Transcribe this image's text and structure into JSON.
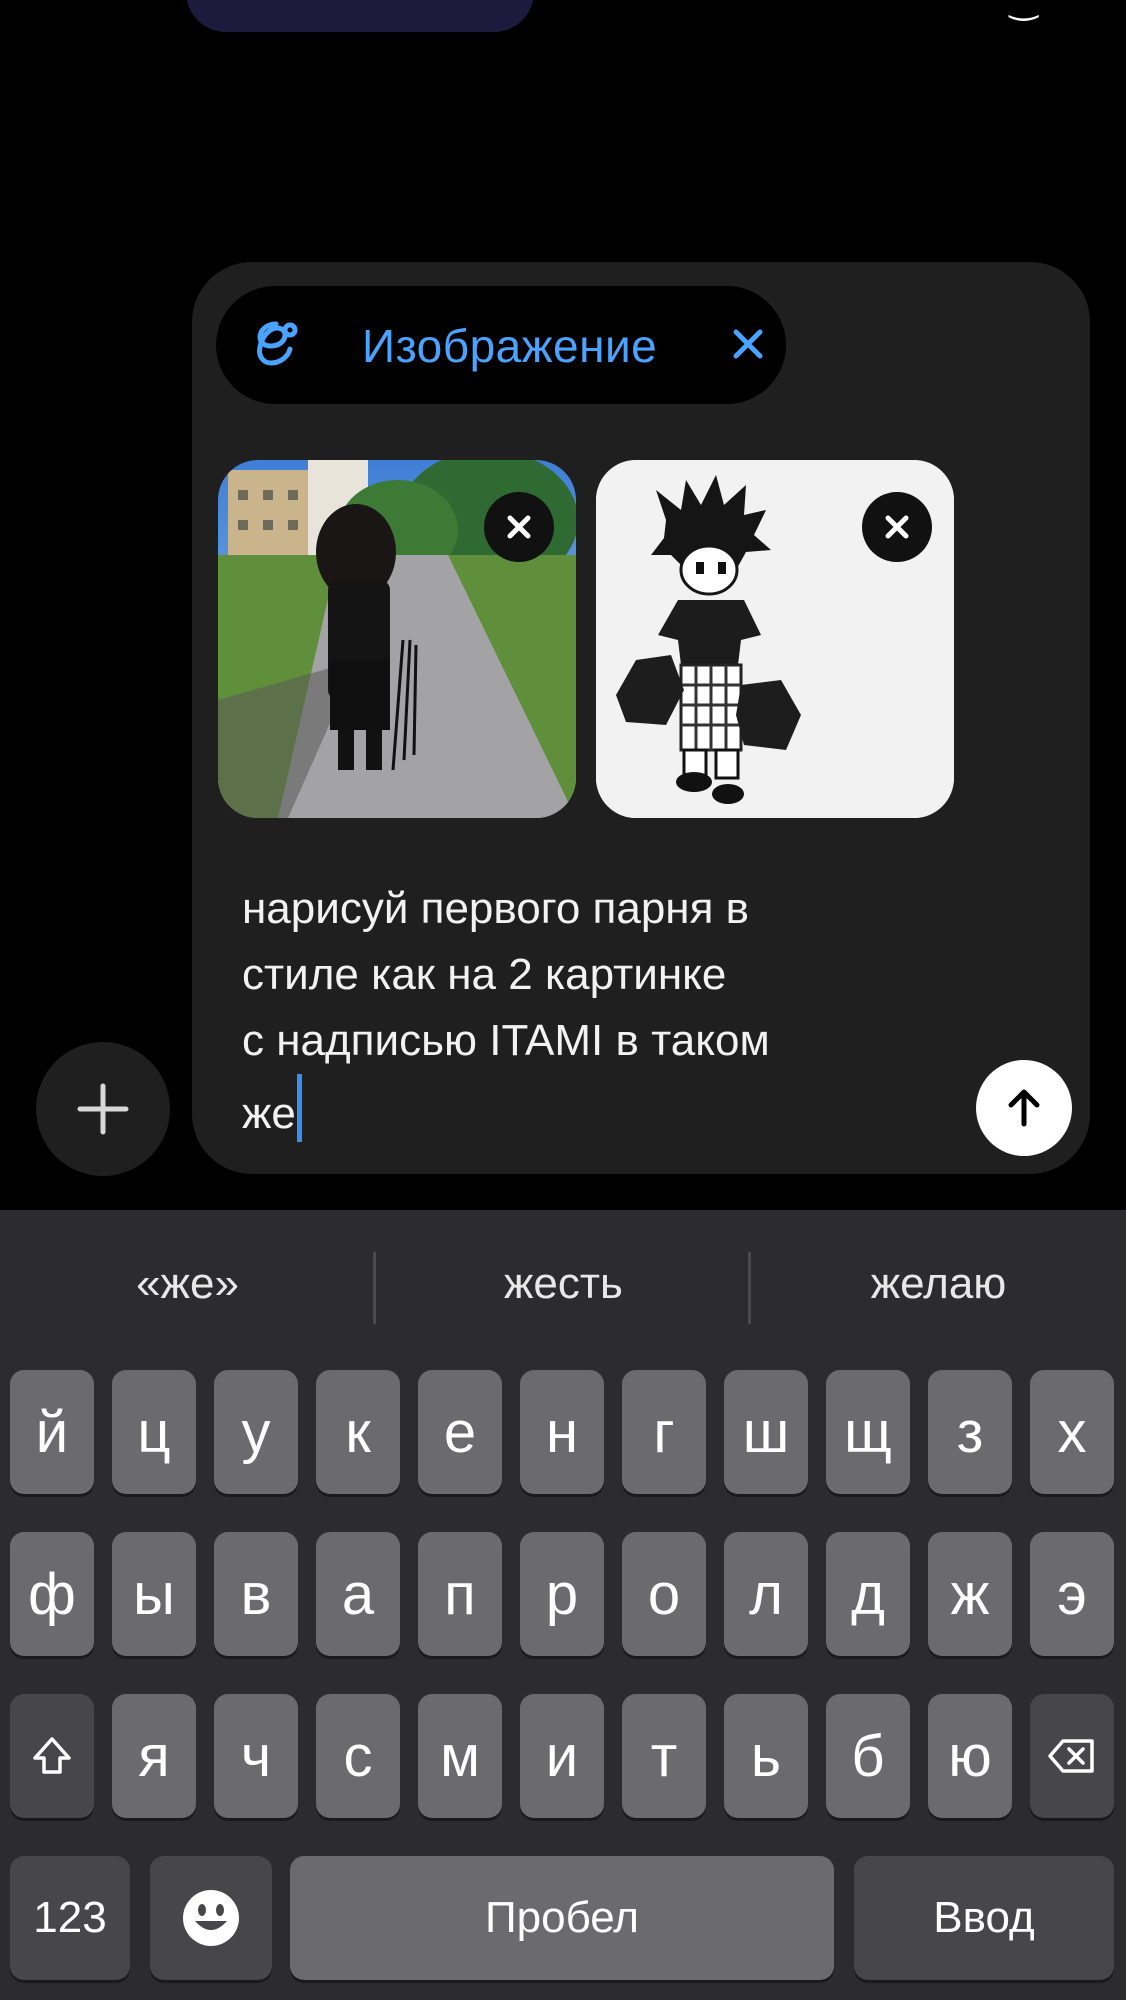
{
  "composer": {
    "chip_label": "Изображение",
    "message_text": "нарисуй первого парня в стиле как на 2 картинке с надписью ITAMI в таком же",
    "message_lines": [
      "нарисуй первого парня в",
      "стиле как на 2 картинке",
      "с надписью ITAMI в таком",
      "же"
    ],
    "attachments": [
      "photo",
      "drawing"
    ]
  },
  "suggestions": [
    "«же»",
    "жесть",
    "желаю"
  ],
  "keyboard": {
    "row1": [
      "й",
      "ц",
      "у",
      "к",
      "е",
      "н",
      "г",
      "ш",
      "щ",
      "з",
      "х"
    ],
    "row2": [
      "ф",
      "ы",
      "в",
      "а",
      "п",
      "р",
      "о",
      "л",
      "д",
      "ж",
      "э"
    ],
    "row3": [
      "я",
      "ч",
      "с",
      "м",
      "и",
      "т",
      "ь",
      "б",
      "ю"
    ],
    "numbers_label": "123",
    "space_label": "Пробел",
    "return_label": "Ввод"
  },
  "colors": {
    "accent": "#4aa3ff",
    "caret": "#3a8ff0"
  }
}
